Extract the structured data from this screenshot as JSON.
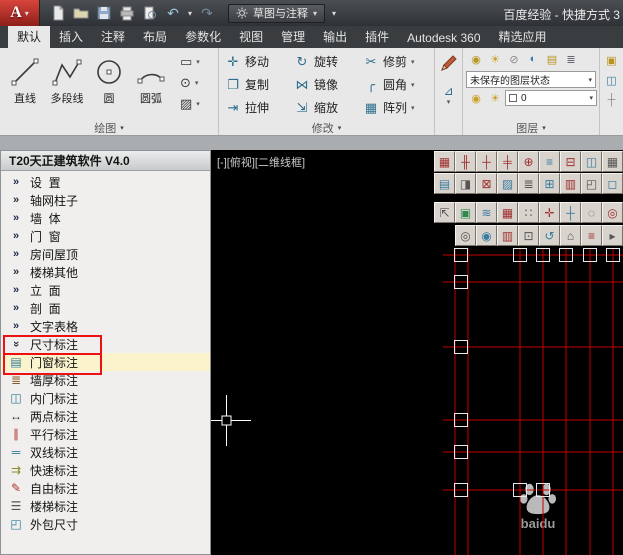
{
  "titlebar": {
    "app_button": "A",
    "workspace": "草图与注释",
    "title": "百度经验 - 快捷方式 3"
  },
  "tabs": [
    {
      "label": "默认",
      "cls": "active"
    },
    {
      "label": "插入"
    },
    {
      "label": "注释"
    },
    {
      "label": "布局"
    },
    {
      "label": "参数化"
    },
    {
      "label": "视图"
    },
    {
      "label": "管理"
    },
    {
      "label": "输出"
    },
    {
      "label": "插件"
    },
    {
      "label": "Autodesk 360"
    },
    {
      "label": "精选应用"
    }
  ],
  "ribbon": {
    "draw_panel": {
      "label": "绘图",
      "buttons": [
        {
          "label": "直线"
        },
        {
          "label": "多段线"
        },
        {
          "label": "圆"
        },
        {
          "label": "圆弧"
        }
      ],
      "small_buttons": [
        {
          "g": "▭"
        },
        {
          "g": "⊙"
        },
        {
          "g": "▨"
        }
      ]
    },
    "modify_panel": {
      "label": "修改",
      "buttons": [
        {
          "g": "✛",
          "label": "移动"
        },
        {
          "g": "↻",
          "label": "旋转"
        },
        {
          "g": "✂",
          "label": "修剪",
          "cls": "has-dd"
        },
        {
          "g": "❐",
          "label": "复制"
        },
        {
          "g": "⋈",
          "label": "镜像"
        },
        {
          "g": "╭",
          "label": "圆角",
          "cls": "has-dd"
        },
        {
          "g": "⇥",
          "label": "拉伸"
        },
        {
          "g": "⇲",
          "label": "缩放"
        },
        {
          "g": "▦",
          "label": "阵列",
          "cls": "has-dd"
        }
      ]
    },
    "anno_panel": {
      "small_glyph": "⊿"
    },
    "layers_panel": {
      "label": "图层",
      "row1_icons": [
        {
          "g": "◉",
          "c": "#b8941f"
        },
        {
          "g": "☀",
          "c": "#c8a028"
        },
        {
          "g": "⊘",
          "c": "#888888"
        },
        {
          "g": "◐",
          "c": "#3a7ba0"
        },
        {
          "g": "▤",
          "c": "#b8941f"
        },
        {
          "g": "≣",
          "c": "#556"
        }
      ],
      "state_combo": "未保存的图层状态",
      "row3_icons": [
        {
          "g": "◉",
          "c": "#c8a028"
        },
        {
          "g": "☀",
          "c": "#c8a028"
        }
      ],
      "current_layer": "0"
    },
    "strip_icons": [
      {
        "g": "▣",
        "c": "#b8941f"
      },
      {
        "g": "◫",
        "c": "#3a7ba0"
      },
      {
        "g": "┼",
        "c": "#888888"
      }
    ]
  },
  "palette": {
    "title": "T20天正建筑软件 V4.0",
    "items": [
      {
        "icon": "»",
        "label": "设  置",
        "cls": "top"
      },
      {
        "icon": "»",
        "label": "轴网柱子",
        "cls": "top"
      },
      {
        "icon": "»",
        "label": "墙  体",
        "cls": "top"
      },
      {
        "icon": "»",
        "label": "门  窗",
        "cls": "top"
      },
      {
        "icon": "»",
        "label": "房间屋顶",
        "cls": "top"
      },
      {
        "icon": "»",
        "label": "楼梯其他",
        "cls": "top"
      },
      {
        "icon": "»",
        "label": "立  面",
        "cls": "top"
      },
      {
        "icon": "»",
        "label": "剖  面",
        "cls": "top"
      },
      {
        "icon": "»",
        "label": "文字表格",
        "cls": "top"
      },
      {
        "icon": "»",
        "label": "尺寸标注",
        "cls": "top expanded redbox"
      },
      {
        "icon": "▤",
        "ic": "#2d7d9a",
        "label": "门窗标注",
        "cls": "sub hl redbox"
      },
      {
        "icon": "≣",
        "ic": "#8a5a2a",
        "label": "墙厚标注",
        "cls": "sub"
      },
      {
        "icon": "◫",
        "ic": "#2d7d9a",
        "label": "内门标注",
        "cls": "sub"
      },
      {
        "icon": "↔",
        "ic": "#333333",
        "label": "两点标注",
        "cls": "sub"
      },
      {
        "icon": "∥",
        "ic": "#b03030",
        "label": "平行标注",
        "cls": "sub"
      },
      {
        "icon": "═",
        "ic": "#2d7d9a",
        "label": "双线标注",
        "cls": "sub"
      },
      {
        "icon": "⇉",
        "ic": "#8a8a2a",
        "label": "快速标注",
        "cls": "sub"
      },
      {
        "icon": "✎",
        "ic": "#b03030",
        "label": "自由标注",
        "cls": "sub"
      },
      {
        "icon": "☰",
        "ic": "#555555",
        "label": "楼梯标注",
        "cls": "sub"
      },
      {
        "icon": "◰",
        "ic": "#2d7d9a",
        "label": "外包尺寸",
        "cls": "sub"
      }
    ]
  },
  "canvas": {
    "viewport_label": "[-][俯视][二维线框]",
    "watermark_text": "baidu"
  },
  "tz": {
    "row1": [
      {
        "g": "▦",
        "c": "#a03030"
      },
      {
        "g": "╫",
        "c": "#a03030"
      },
      {
        "g": "┼",
        "c": "#a03030"
      },
      {
        "g": "╪",
        "c": "#a03030"
      },
      {
        "g": "⊕",
        "c": "#a03030"
      },
      {
        "g": "≡",
        "c": "#3a7ba0"
      },
      {
        "g": "⊟",
        "c": "#a03030"
      },
      {
        "g": "◫",
        "c": "#3a7ba0"
      },
      {
        "g": "▦",
        "c": "#555555"
      }
    ],
    "row2": [
      {
        "g": "▤",
        "c": "#3a7ba0"
      },
      {
        "g": "◨",
        "c": "#555555"
      },
      {
        "g": "⊠",
        "c": "#a03030"
      },
      {
        "g": "▨",
        "c": "#3a7ba0"
      },
      {
        "g": "≣",
        "c": "#555555"
      },
      {
        "g": "⊞",
        "c": "#3a7ba0"
      },
      {
        "g": "▥",
        "c": "#a03030"
      },
      {
        "g": "◰",
        "c": "#555555"
      },
      {
        "g": "◻",
        "c": "#3a7ba0"
      }
    ],
    "row3": [
      {
        "g": "⇱",
        "c": "#555555"
      },
      {
        "g": "▣",
        "c": "#2d8a4a"
      },
      {
        "g": "≋",
        "c": "#3a7ba0"
      },
      {
        "g": "▦",
        "c": "#a03030"
      },
      {
        "g": "∷",
        "c": "#555555"
      },
      {
        "g": "✛",
        "c": "#a03030"
      },
      {
        "g": "┼",
        "c": "#3a7ba0"
      },
      {
        "g": "◌",
        "c": "#555555"
      },
      {
        "g": "◎",
        "c": "#a03030"
      }
    ],
    "row4": [
      {
        "g": "◎",
        "c": "#555555"
      },
      {
        "g": "◉",
        "c": "#3a7ba0"
      },
      {
        "g": "▥",
        "c": "#a03030"
      },
      {
        "g": "⊡",
        "c": "#555555"
      },
      {
        "g": "↺",
        "c": "#3a7ba0"
      },
      {
        "g": "⌂",
        "c": "#555555"
      },
      {
        "g": "≡",
        "c": "#a03030"
      },
      {
        "g": "▸",
        "c": "#555555"
      }
    ]
  }
}
